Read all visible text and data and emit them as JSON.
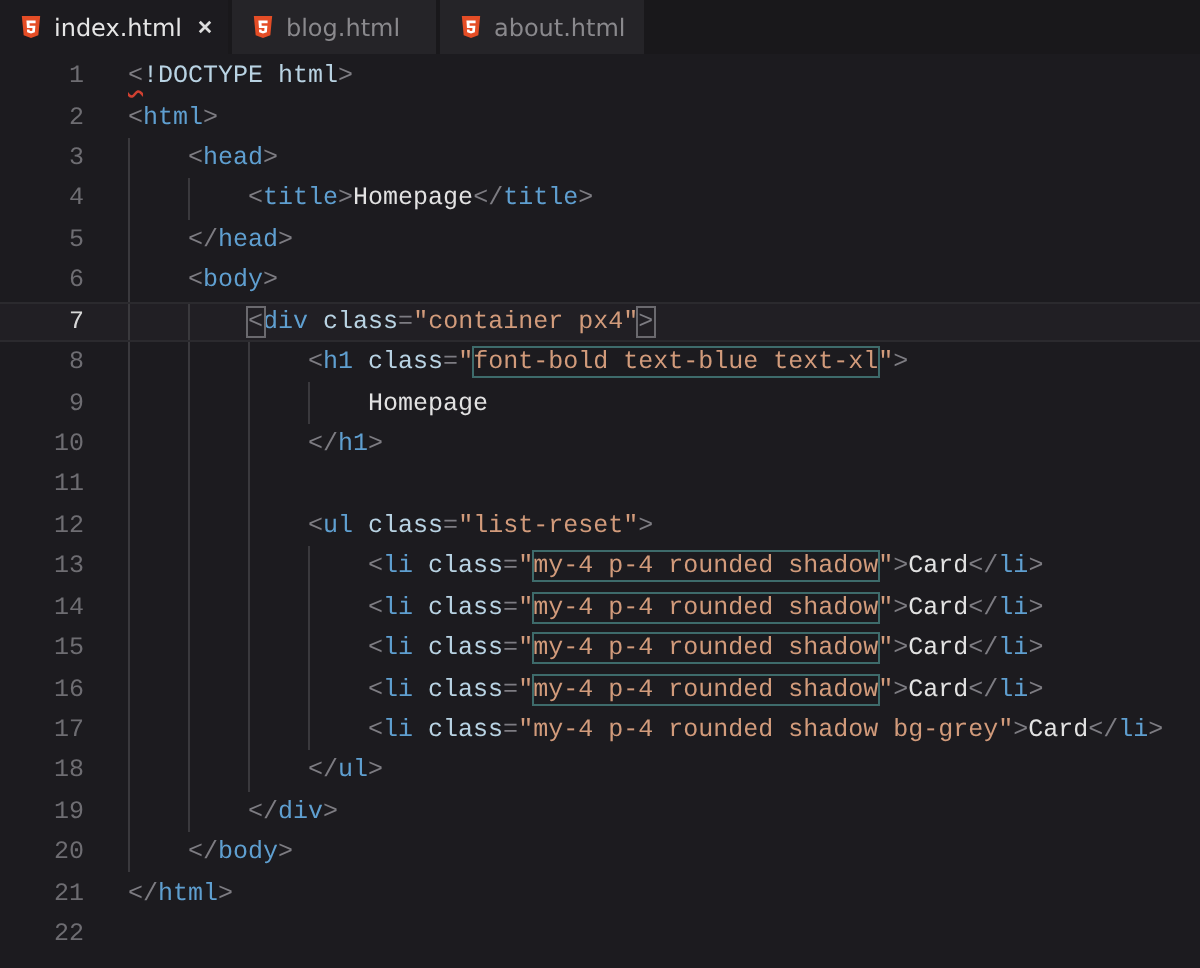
{
  "tabs": [
    {
      "label": "index.html",
      "selected": true
    },
    {
      "label": "blog.html",
      "selected": false
    },
    {
      "label": "about.html",
      "selected": false
    }
  ],
  "lines": [
    {
      "number": "1",
      "current": false,
      "tokens": [
        {
          "kind": "punct",
          "text": "<",
          "error": true
        },
        {
          "kind": "attr",
          "text": "!DOCTYPE "
        },
        {
          "kind": "attr",
          "text": "html"
        },
        {
          "kind": "punct",
          "text": ">"
        }
      ]
    },
    {
      "number": "2",
      "current": false,
      "tokens": [
        {
          "kind": "punct",
          "text": "<"
        },
        {
          "kind": "tag",
          "text": "html"
        },
        {
          "kind": "punct",
          "text": ">"
        }
      ],
      "children": [
        {
          "number": "3",
          "current": false,
          "tokens": [
            {
              "kind": "punct",
              "text": "<"
            },
            {
              "kind": "tag",
              "text": "head"
            },
            {
              "kind": "punct",
              "text": ">"
            }
          ],
          "children": [
            {
              "number": "4",
              "current": false,
              "tokens": [
                {
                  "kind": "punct",
                  "text": "<"
                },
                {
                  "kind": "tag",
                  "text": "title"
                },
                {
                  "kind": "punct",
                  "text": ">"
                },
                {
                  "kind": "text",
                  "text": "Homepage"
                },
                {
                  "kind": "punct",
                  "text": "</"
                },
                {
                  "kind": "tag",
                  "text": "title"
                },
                {
                  "kind": "punct",
                  "text": ">"
                }
              ]
            }
          ]
        },
        {
          "number": "5",
          "current": false,
          "tokens": [
            {
              "kind": "punct",
              "text": "</"
            },
            {
              "kind": "tag",
              "text": "head"
            },
            {
              "kind": "punct",
              "text": ">"
            }
          ]
        },
        {
          "number": "6",
          "current": false,
          "tokens": [
            {
              "kind": "punct",
              "text": "<"
            },
            {
              "kind": "tag",
              "text": "body"
            },
            {
              "kind": "punct",
              "text": ">"
            }
          ],
          "children": [
            {
              "number": "7",
              "current": true,
              "tokens": [
                {
                  "kind": "punct",
                  "text": "<",
                  "boxed": true
                },
                {
                  "kind": "tag",
                  "text": "div"
                },
                {
                  "kind": "attr",
                  "text": " class"
                },
                {
                  "kind": "punct",
                  "text": "="
                },
                {
                  "kind": "string",
                  "text": "\"container px4\""
                },
                {
                  "kind": "punct",
                  "text": ">",
                  "boxed": true
                }
              ],
              "children": [
                {
                  "number": "8",
                  "current": false,
                  "tokens": [
                    {
                      "kind": "punct",
                      "text": "<"
                    },
                    {
                      "kind": "tag",
                      "text": "h1"
                    },
                    {
                      "kind": "attr",
                      "text": " class"
                    },
                    {
                      "kind": "punct",
                      "text": "="
                    },
                    {
                      "kind": "string",
                      "text": "\""
                    },
                    {
                      "kind": "string",
                      "text": "font-bold text-blue text-xl",
                      "boxed": true
                    },
                    {
                      "kind": "string",
                      "text": "\""
                    },
                    {
                      "kind": "punct",
                      "text": ">"
                    }
                  ],
                  "children": [
                    {
                      "number": "9",
                      "current": false,
                      "tokens": [
                        {
                          "kind": "text",
                          "text": "Homepage"
                        }
                      ]
                    }
                  ]
                },
                {
                  "number": "10",
                  "current": false,
                  "tokens": [
                    {
                      "kind": "punct",
                      "text": "</"
                    },
                    {
                      "kind": "tag",
                      "text": "h1"
                    },
                    {
                      "kind": "punct",
                      "text": ">"
                    }
                  ]
                },
                {
                  "number": "11",
                  "current": false
                },
                {
                  "number": "12",
                  "current": false,
                  "tokens": [
                    {
                      "kind": "punct",
                      "text": "<"
                    },
                    {
                      "kind": "tag",
                      "text": "ul"
                    },
                    {
                      "kind": "attr",
                      "text": " class"
                    },
                    {
                      "kind": "punct",
                      "text": "="
                    },
                    {
                      "kind": "string",
                      "text": "\"list-reset\""
                    },
                    {
                      "kind": "punct",
                      "text": ">"
                    }
                  ],
                  "children": [
                    {
                      "number": "13",
                      "current": false,
                      "tokens": [
                        {
                          "kind": "punct",
                          "text": "<"
                        },
                        {
                          "kind": "tag",
                          "text": "li"
                        },
                        {
                          "kind": "attr",
                          "text": " class"
                        },
                        {
                          "kind": "punct",
                          "text": "="
                        },
                        {
                          "kind": "string",
                          "text": "\""
                        },
                        {
                          "kind": "string",
                          "text": "my-4 p-4 rounded shadow",
                          "boxed": true
                        },
                        {
                          "kind": "string",
                          "text": "\""
                        },
                        {
                          "kind": "punct",
                          "text": ">"
                        },
                        {
                          "kind": "text",
                          "text": "Card"
                        },
                        {
                          "kind": "punct",
                          "text": "</"
                        },
                        {
                          "kind": "tag",
                          "text": "li"
                        },
                        {
                          "kind": "punct",
                          "text": ">"
                        }
                      ]
                    },
                    {
                      "number": "14",
                      "current": false,
                      "tokens": [
                        {
                          "kind": "punct",
                          "text": "<"
                        },
                        {
                          "kind": "tag",
                          "text": "li"
                        },
                        {
                          "kind": "attr",
                          "text": " class"
                        },
                        {
                          "kind": "punct",
                          "text": "="
                        },
                        {
                          "kind": "string",
                          "text": "\""
                        },
                        {
                          "kind": "string",
                          "text": "my-4 p-4 rounded shadow",
                          "boxed": true
                        },
                        {
                          "kind": "string",
                          "text": "\""
                        },
                        {
                          "kind": "punct",
                          "text": ">"
                        },
                        {
                          "kind": "text",
                          "text": "Card"
                        },
                        {
                          "kind": "punct",
                          "text": "</"
                        },
                        {
                          "kind": "tag",
                          "text": "li"
                        },
                        {
                          "kind": "punct",
                          "text": ">"
                        }
                      ]
                    },
                    {
                      "number": "15",
                      "current": false,
                      "tokens": [
                        {
                          "kind": "punct",
                          "text": "<"
                        },
                        {
                          "kind": "tag",
                          "text": "li"
                        },
                        {
                          "kind": "attr",
                          "text": " class"
                        },
                        {
                          "kind": "punct",
                          "text": "="
                        },
                        {
                          "kind": "string",
                          "text": "\""
                        },
                        {
                          "kind": "string",
                          "text": "my-4 p-4 rounded shadow",
                          "boxed": true
                        },
                        {
                          "kind": "string",
                          "text": "\""
                        },
                        {
                          "kind": "punct",
                          "text": ">"
                        },
                        {
                          "kind": "text",
                          "text": "Card"
                        },
                        {
                          "kind": "punct",
                          "text": "</"
                        },
                        {
                          "kind": "tag",
                          "text": "li"
                        },
                        {
                          "kind": "punct",
                          "text": ">"
                        }
                      ]
                    },
                    {
                      "number": "16",
                      "current": false,
                      "tokens": [
                        {
                          "kind": "punct",
                          "text": "<"
                        },
                        {
                          "kind": "tag",
                          "text": "li"
                        },
                        {
                          "kind": "attr",
                          "text": " class"
                        },
                        {
                          "kind": "punct",
                          "text": "="
                        },
                        {
                          "kind": "string",
                          "text": "\""
                        },
                        {
                          "kind": "string",
                          "text": "my-4 p-4 rounded shadow",
                          "boxed": true
                        },
                        {
                          "kind": "string",
                          "text": "\""
                        },
                        {
                          "kind": "punct",
                          "text": ">"
                        },
                        {
                          "kind": "text",
                          "text": "Card"
                        },
                        {
                          "kind": "punct",
                          "text": "</"
                        },
                        {
                          "kind": "tag",
                          "text": "li"
                        },
                        {
                          "kind": "punct",
                          "text": ">"
                        }
                      ]
                    },
                    {
                      "number": "17",
                      "current": false,
                      "tokens": [
                        {
                          "kind": "punct",
                          "text": "<"
                        },
                        {
                          "kind": "tag",
                          "text": "li"
                        },
                        {
                          "kind": "attr",
                          "text": " class"
                        },
                        {
                          "kind": "punct",
                          "text": "="
                        },
                        {
                          "kind": "string",
                          "text": "\"my-4 p-4 rounded shadow bg-grey\""
                        },
                        {
                          "kind": "punct",
                          "text": ">"
                        },
                        {
                          "kind": "text",
                          "text": "Card"
                        },
                        {
                          "kind": "punct",
                          "text": "</"
                        },
                        {
                          "kind": "tag",
                          "text": "li"
                        },
                        {
                          "kind": "punct",
                          "text": ">"
                        }
                      ]
                    }
                  ]
                },
                {
                  "number": "18",
                  "current": false,
                  "tokens": [
                    {
                      "kind": "punct",
                      "text": "</"
                    },
                    {
                      "kind": "tag",
                      "text": "ul"
                    },
                    {
                      "kind": "punct",
                      "text": ">"
                    }
                  ]
                }
              ]
            },
            {
              "number": "19",
              "current": false,
              "tokens": [
                {
                  "kind": "punct",
                  "text": "</"
                },
                {
                  "kind": "tag",
                  "text": "div"
                },
                {
                  "kind": "punct",
                  "text": ">"
                }
              ]
            }
          ]
        },
        {
          "number": "20",
          "current": false,
          "tokens": [
            {
              "kind": "punct",
              "text": "</"
            },
            {
              "kind": "tag",
              "text": "body"
            },
            {
              "kind": "punct",
              "text": ">"
            }
          ]
        }
      ]
    },
    {
      "number": "21",
      "current": false,
      "tokens": [
        {
          "kind": "punct",
          "text": "</"
        },
        {
          "kind": "tag",
          "text": "html"
        },
        {
          "kind": "punct",
          "text": ">"
        }
      ]
    },
    {
      "number": "22",
      "current": false
    }
  ]
}
